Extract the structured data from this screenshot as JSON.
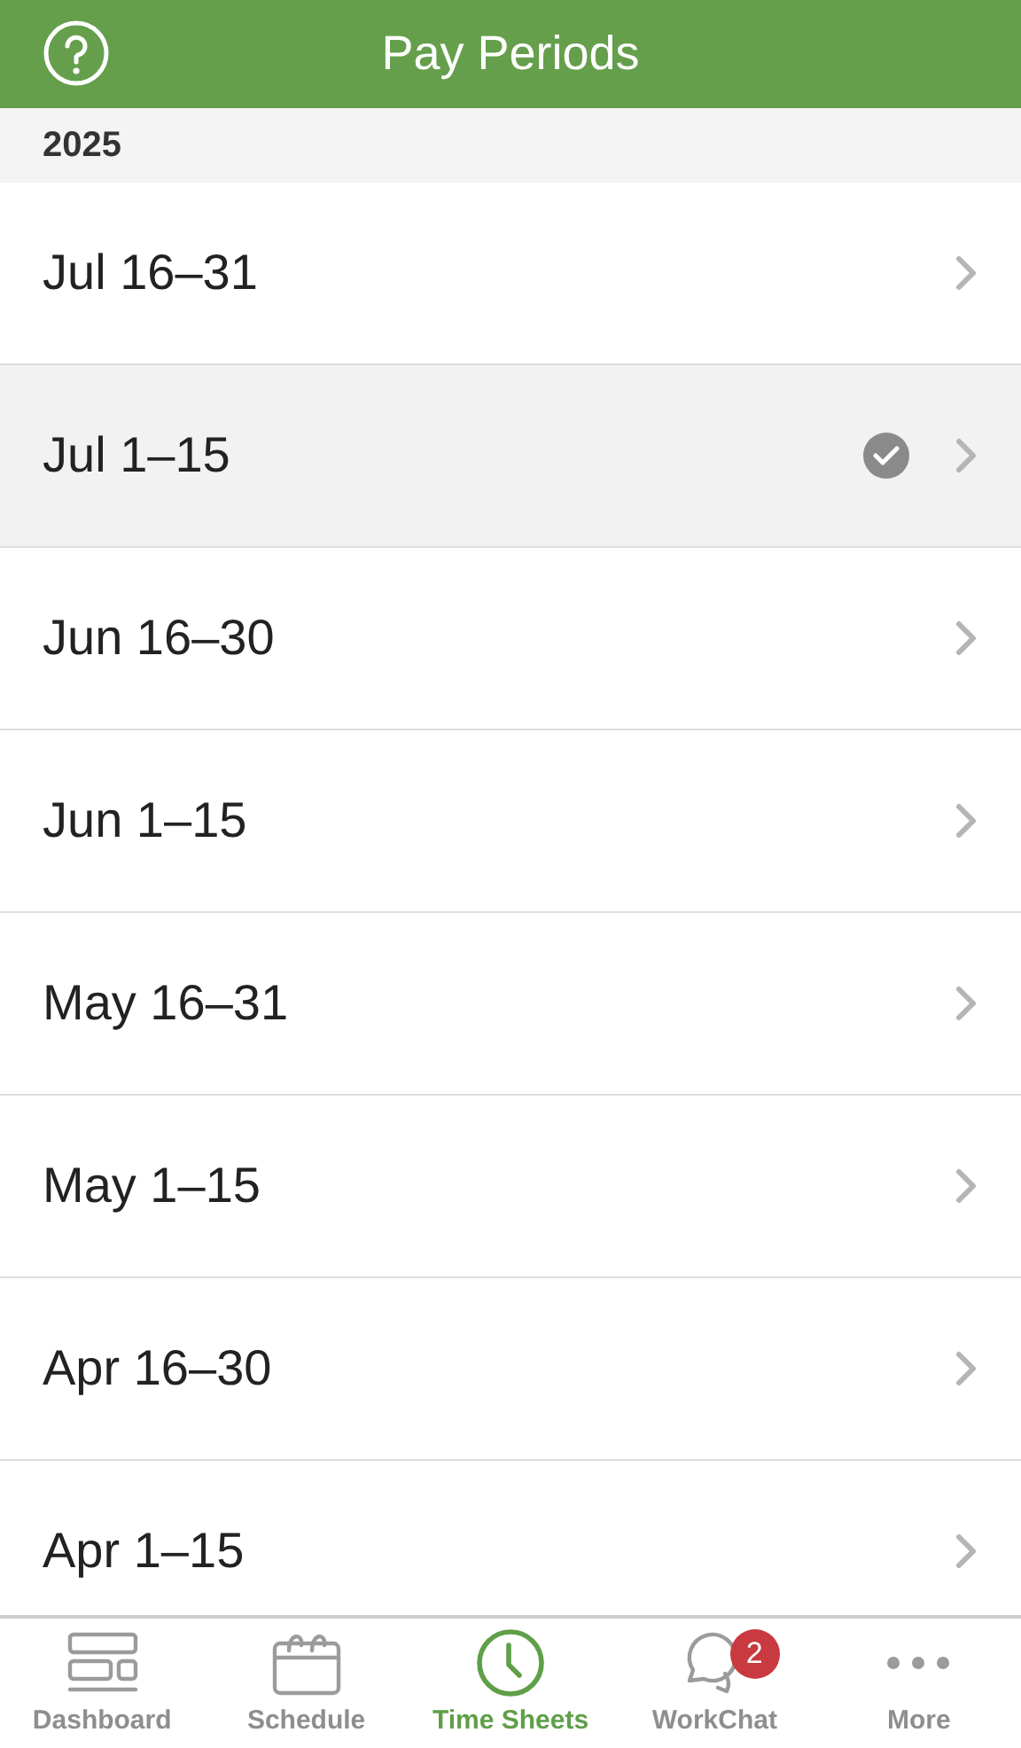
{
  "header": {
    "title": "Pay Periods"
  },
  "section": {
    "label": "2025"
  },
  "periods": [
    {
      "label": "Jul 16–31",
      "selected": false,
      "approved": false
    },
    {
      "label": "Jul 1–15",
      "selected": true,
      "approved": true
    },
    {
      "label": "Jun 16–30",
      "selected": false,
      "approved": false
    },
    {
      "label": "Jun 1–15",
      "selected": false,
      "approved": false
    },
    {
      "label": "May 16–31",
      "selected": false,
      "approved": false
    },
    {
      "label": "May 1–15",
      "selected": false,
      "approved": false
    },
    {
      "label": "Apr 16–30",
      "selected": false,
      "approved": false
    },
    {
      "label": "Apr 1–15",
      "selected": false,
      "approved": false
    }
  ],
  "tabs": [
    {
      "kind": "dashboard",
      "label": "Dashboard",
      "selected": false
    },
    {
      "kind": "schedule",
      "label": "Schedule",
      "selected": false
    },
    {
      "kind": "timesheets",
      "label": "Time Sheets",
      "selected": true
    },
    {
      "kind": "chat",
      "label": "WorkChat",
      "selected": false,
      "badge": "2"
    },
    {
      "kind": "more",
      "label": "More",
      "selected": false
    }
  ]
}
